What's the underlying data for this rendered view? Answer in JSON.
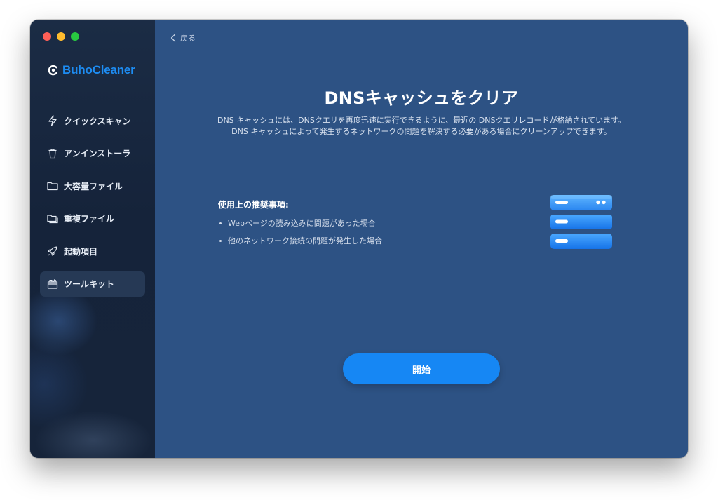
{
  "app": {
    "name": "BuhoCleaner"
  },
  "sidebar": {
    "items": [
      {
        "label": "クイックスキャン",
        "icon": "bolt-icon"
      },
      {
        "label": "アンインストーラ",
        "icon": "trash-icon"
      },
      {
        "label": "大容量ファイル",
        "icon": "folder-icon"
      },
      {
        "label": "重複ファイル",
        "icon": "duplicate-folder-icon"
      },
      {
        "label": "起動項目",
        "icon": "rocket-icon"
      },
      {
        "label": "ツールキット",
        "icon": "toolkit-icon",
        "active": true
      }
    ]
  },
  "header": {
    "back_label": "戻る"
  },
  "main": {
    "title": "DNSキャッシュをクリア",
    "description": "DNS キャッシュには、DNSクエリを再度迅速に実行できるように、最近の DNSクエリレコードが格納されています。DNS キャッシュによって発生するネットワークの問題を解決する必要がある場合にクリーンアップできます。",
    "recommend_heading": "使用上の推奨事項:",
    "recommendations": [
      "Webページの読み込みに問題があった場合",
      "他のネットワーク接続の問題が発生した場合"
    ],
    "start_label": "開始"
  },
  "colors": {
    "accent": "#1687f4",
    "brand": "#1d8cf2",
    "main_bg": "#2d5284",
    "sidebar_bg": "#16243a"
  }
}
